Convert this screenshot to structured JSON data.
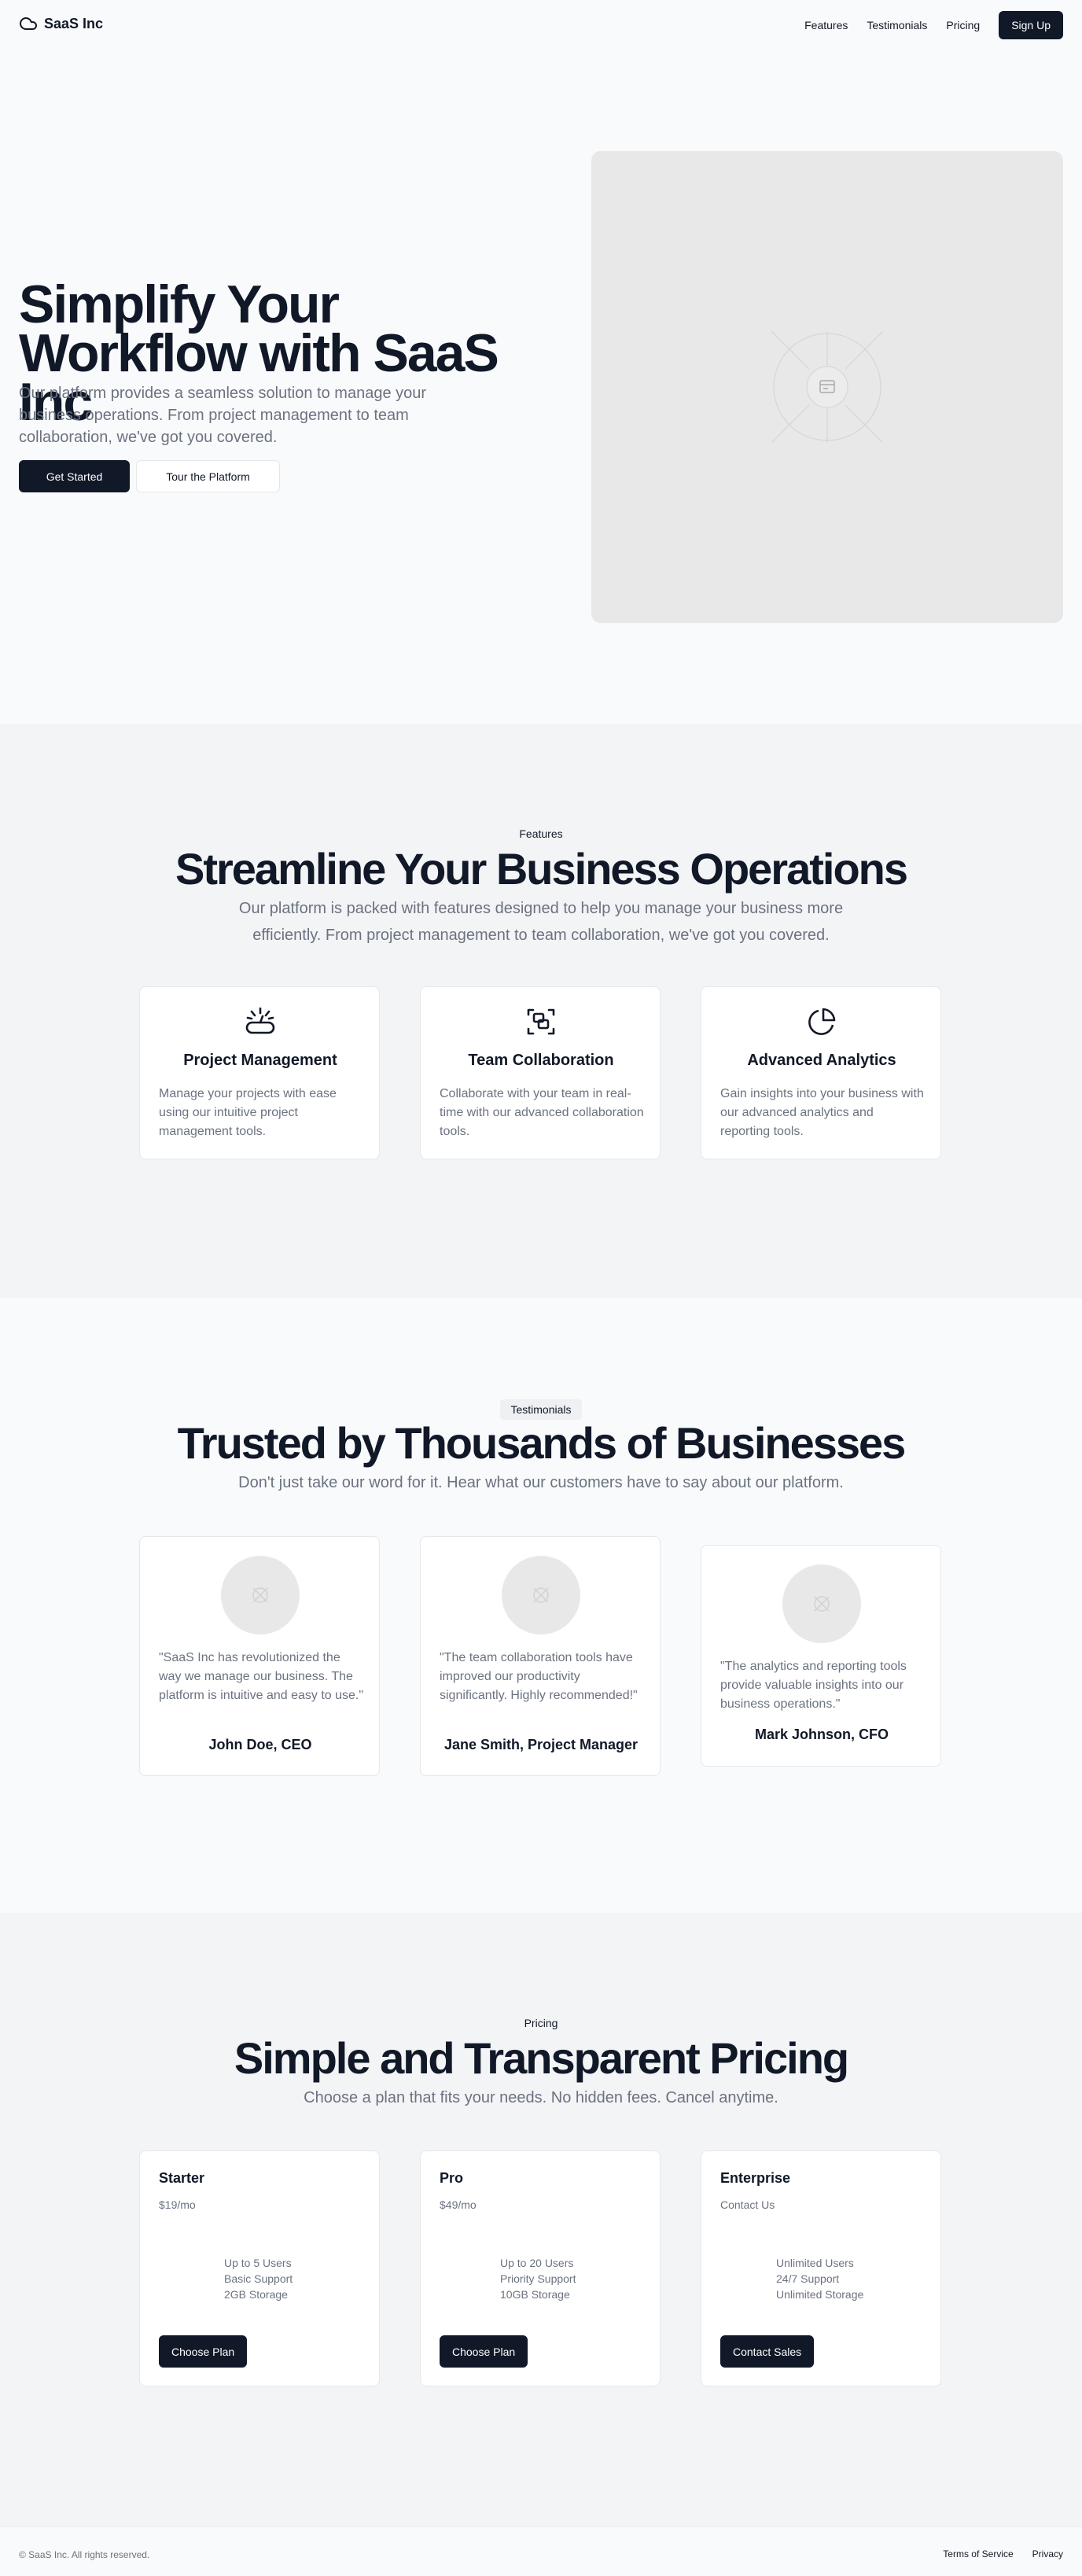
{
  "header": {
    "brand": "SaaS Inc",
    "nav": [
      "Features",
      "Testimonials",
      "Pricing"
    ],
    "signup": "Sign Up"
  },
  "hero": {
    "title": "Simplify Your Workflow with SaaS Inc",
    "subtitle": "Our platform provides a seamless solution to manage your business operations. From project management to team collaboration, we've got you covered.",
    "primary_cta": "Get Started",
    "secondary_cta": "Tour the Platform"
  },
  "features": {
    "kicker": "Features",
    "title": "Streamline Your Business Operations",
    "subtitle": "Our platform is packed with features designed to help you manage your business more efficiently. From project management to team collaboration, we've got you covered.",
    "items": [
      {
        "icon": "project-management-icon",
        "title": "Project Management",
        "desc": "Manage your projects with ease using our intuitive project management tools."
      },
      {
        "icon": "team-collaboration-icon",
        "title": "Team Collaboration",
        "desc": "Collaborate with your team in real-time with our advanced collaboration tools."
      },
      {
        "icon": "pie-chart-icon",
        "title": "Advanced Analytics",
        "desc": "Gain insights into your business with our advanced analytics and reporting tools."
      }
    ]
  },
  "testimonials": {
    "kicker": "Testimonials",
    "title": "Trusted by Thousands of Businesses",
    "subtitle": "Don't just take our word for it. Hear what our customers have to say about our platform.",
    "items": [
      {
        "quote": "\"SaaS Inc has revolutionized the way we manage our business. The platform is intuitive and easy to use.\"",
        "name": "John Doe, CEO"
      },
      {
        "quote": "\"The team collaboration tools have improved our productivity significantly. Highly recommended!\"",
        "name": "Jane Smith, Project Manager"
      },
      {
        "quote": "\"The analytics and reporting tools provide valuable insights into our business operations.\"",
        "name": "Mark Johnson, CFO"
      }
    ]
  },
  "pricing": {
    "kicker": "Pricing",
    "title": "Simple and Transparent Pricing",
    "subtitle": "Choose a plan that fits your needs. No hidden fees. Cancel anytime.",
    "plans": [
      {
        "name": "Starter",
        "price": "$19/mo",
        "features": [
          "Up to 5 Users",
          "Basic Support",
          "2GB Storage"
        ],
        "cta": "Choose Plan"
      },
      {
        "name": "Pro",
        "price": "$49/mo",
        "features": [
          "Up to 20 Users",
          "Priority Support",
          "10GB Storage"
        ],
        "cta": "Choose Plan"
      },
      {
        "name": "Enterprise",
        "price": "Contact Us",
        "features": [
          "Unlimited Users",
          "24/7 Support",
          "Unlimited Storage"
        ],
        "cta": "Contact Sales"
      }
    ]
  },
  "footer": {
    "copyright": "© SaaS Inc. All rights reserved.",
    "links": [
      "Terms of Service",
      "Privacy"
    ]
  },
  "colors": {
    "primary": "#111827",
    "muted_text": "#6b7280",
    "section_gray": "#f3f4f6",
    "background": "#f9fafb"
  }
}
